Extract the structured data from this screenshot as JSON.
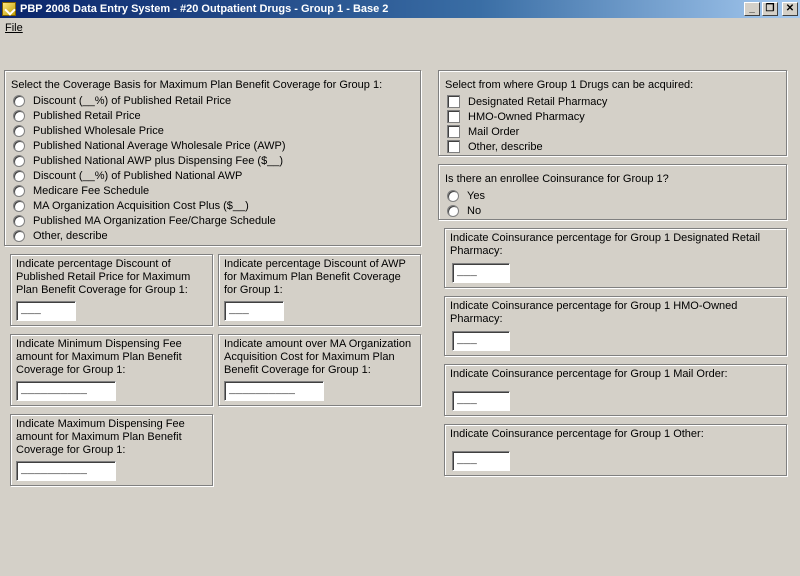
{
  "window": {
    "title": "PBP 2008 Data Entry System - #20 Outpatient Drugs - Group 1 - Base 2",
    "min_glyph": "_",
    "max_glyph": "❐",
    "close_glyph": "✕"
  },
  "menu": {
    "file": "File"
  },
  "coverage_basis": {
    "label": "Select the Coverage Basis for Maximum Plan Benefit Coverage for Group 1:",
    "options": [
      "Discount (__%) of Published Retail Price",
      "Published Retail Price",
      "Published Wholesale Price",
      "Published National Average Wholesale Price (AWP)",
      "Published National AWP plus Dispensing Fee ($__)",
      "Discount (__%) of Published National AWP",
      "Medicare Fee Schedule",
      "MA Organization Acquisition Cost Plus ($__)",
      "Published MA Organization Fee/Charge Schedule",
      "Other, describe"
    ]
  },
  "pct_discount_retail": {
    "label": "Indicate percentage Discount of Published Retail Price for Maximum Plan Benefit Coverage for Group 1:",
    "value": "___"
  },
  "pct_discount_awp": {
    "label": "Indicate percentage Discount of AWP for Maximum Plan Benefit Coverage for Group 1:",
    "value": "___"
  },
  "min_dispensing_fee": {
    "label": "Indicate Minimum Dispensing Fee amount for Maximum Plan Benefit Coverage for Group 1:",
    "value": "__________"
  },
  "amount_over_ma": {
    "label": "Indicate amount over MA Organization Acquisition Cost for Maximum Plan Benefit Coverage for Group 1:",
    "value": "__________"
  },
  "max_dispensing_fee": {
    "label": "Indicate Maximum Dispensing Fee amount for Maximum Plan Benefit Coverage for Group 1:",
    "value": "__________"
  },
  "acquire_from": {
    "label": "Select from where Group 1 Drugs can be acquired:",
    "options": [
      "Designated Retail Pharmacy",
      "HMO-Owned Pharmacy",
      "Mail Order",
      "Other, describe"
    ]
  },
  "coinsurance_question": {
    "label": "Is there an enrollee Coinsurance for Group 1?",
    "options": [
      "Yes",
      "No"
    ]
  },
  "coins_retail": {
    "label": "Indicate Coinsurance percentage for Group 1 Designated Retail Pharmacy:",
    "value": "___"
  },
  "coins_hmo": {
    "label": "Indicate Coinsurance percentage for Group 1 HMO-Owned Pharmacy:",
    "value": "___"
  },
  "coins_mail": {
    "label": "Indicate Coinsurance percentage for Group 1 Mail Order:",
    "value": "___"
  },
  "coins_other": {
    "label": "Indicate Coinsurance percentage for Group 1 Other:",
    "value": "___"
  }
}
